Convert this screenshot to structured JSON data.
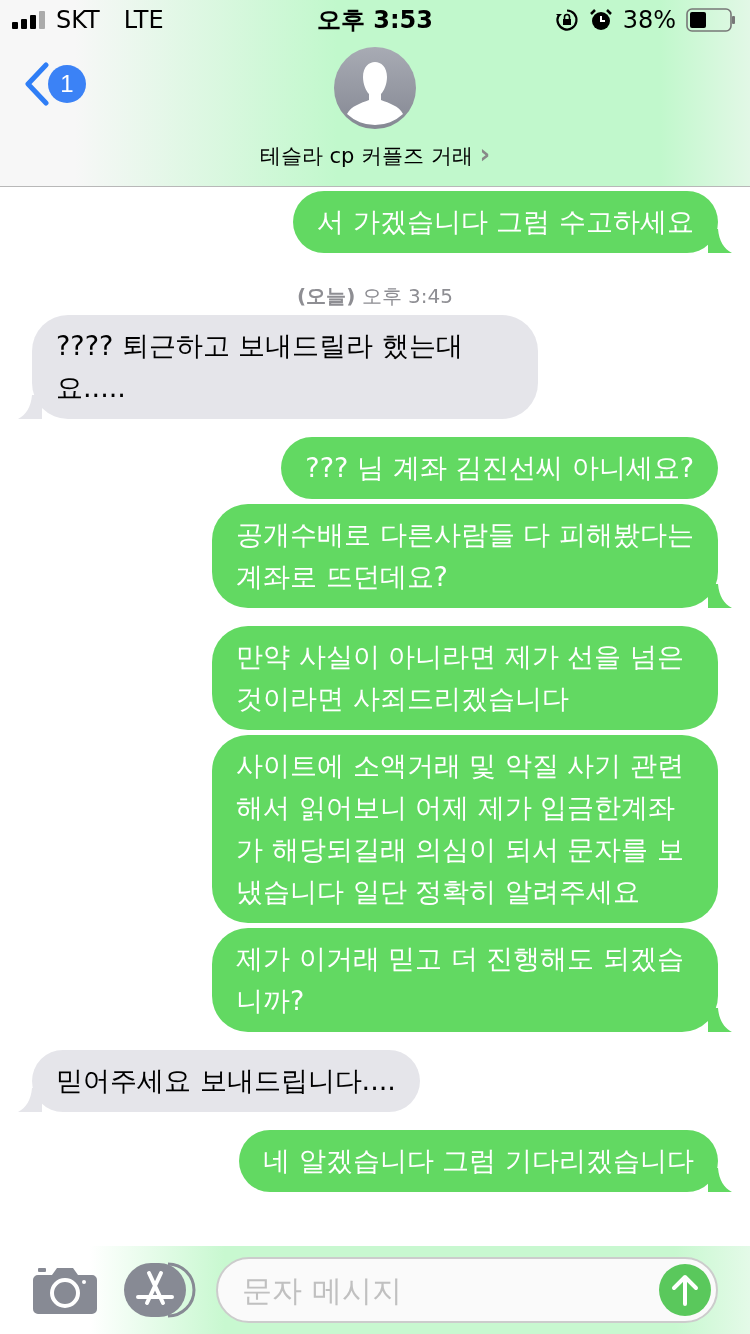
{
  "status_bar": {
    "carrier": "SKT",
    "network": "LTE",
    "time": "오후 3:53",
    "battery": "38%"
  },
  "header": {
    "back_badge": "1",
    "contact": "테슬라 cp 커플즈 거래",
    "chevron": "›"
  },
  "messages": [
    {
      "kind": "sent",
      "text": "서 가겠습니다 그럼 수고하세요",
      "tail": true
    },
    {
      "kind": "time",
      "text": "**(오늘)** 오후 3:45"
    },
    {
      "kind": "received",
      "text": "???? 퇴근하고 보내드릴라 했는대요.....",
      "tail": true
    },
    {
      "kind": "sent",
      "text": "??? 님 계좌 김진선씨 아니세요?",
      "tail": false
    },
    {
      "kind": "sent",
      "text": "공개수배로 다른사람들 다 피해봤다는 계좌로 뜨던데요?",
      "tail": true
    },
    {
      "kind": "sent",
      "text": "만약 사실이 아니라면 제가 선을 넘은것이라면 사죄드리겠습니다",
      "tail": false
    },
    {
      "kind": "sent",
      "text": "사이트에 소액거래 및 악질 사기 관련해서 읽어보니 어제 제가 입금한계좌가 해당되길래 의심이 되서 문자를 보냈습니다 일단 정확히 알려주세요",
      "tail": false
    },
    {
      "kind": "sent",
      "text": "제가 이거래 믿고 더 진행해도 되겠습니까?",
      "tail": true
    },
    {
      "kind": "received",
      "text": "믿어주세요 보내드립니다....",
      "tail": true
    },
    {
      "kind": "sent",
      "text": "네 알겠습니다 그럼 기다리겠습니다",
      "tail": true
    }
  ],
  "composer": {
    "placeholder": "문자 메시지"
  }
}
